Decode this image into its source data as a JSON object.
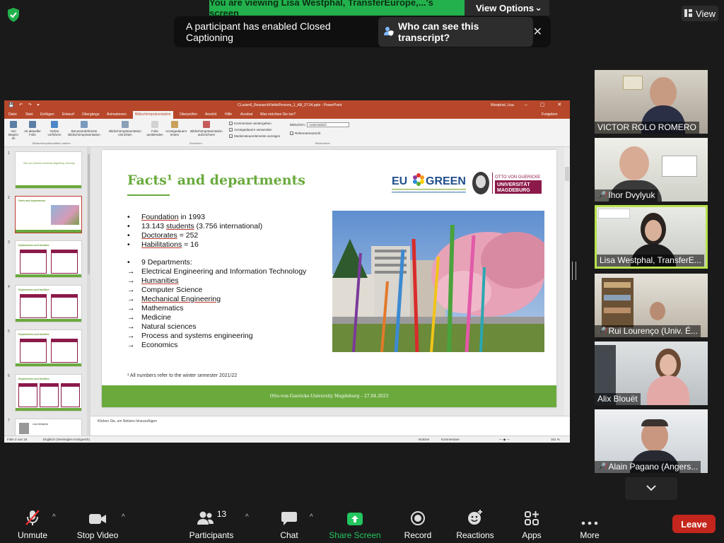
{
  "banner": {
    "sharing_text": "You are viewing Lisa Westphal, TransferEurope,...'s screen",
    "view_options": "View Options"
  },
  "top_view": "View",
  "caption_popup": {
    "message": "A participant has enabled Closed Captioning",
    "button": "Who can see this transcript?"
  },
  "ppt": {
    "title": "CLuster6_ResearchFieldsPersons_1_AB_27.04.pptx  -  PowerPoint",
    "user": "Westphal, Lisa",
    "tabs": [
      "Datei",
      "Start",
      "Einfügen",
      "Entwurf",
      "Übergänge",
      "Animationen",
      "Bildschirmpräsentation",
      "Überprüfen",
      "Ansicht",
      "Hilfe",
      "Acrobat",
      "Was möchten Sie tun?",
      "Freigeben"
    ],
    "ribbon": {
      "buttons": [
        "Von Beginn an",
        "Ab aktueller Folie",
        "Online vorführen",
        "Benutzerdefinierte Bildschirmpräsentation",
        "Bildschirmpräsentation einrichten",
        "Folie ausblenden",
        "Anzeigedauern testen",
        "Bildschirmpräsentation aufzeichnen"
      ],
      "checkboxes": [
        "Kommentare wiedergeben",
        "Anzeigedauern verwenden",
        "Mediensteuerelemente anzeigen"
      ],
      "groups": [
        "Bildschirmpräsentation starten",
        "Einrichten",
        "Bildschirme"
      ],
      "monitor_label": "Bildschirm:",
      "monitor_value": "Automatisch",
      "presenter_view": "Referentenansicht"
    },
    "notes_placeholder": "Klicken Sie, um Notizen hinzuzufügen",
    "status": {
      "slide": "Folie 2 von 15",
      "language": "Englisch (Vereinigtes Königreich)",
      "notes": "Notizen",
      "comments": "Kommentare",
      "zoom": "161 %"
    },
    "thumbs": [
      {
        "num": "1",
        "title": "Otto-von-Guericke-University Magdeburg, Germany"
      },
      {
        "num": "2",
        "title": "Facts and departments"
      },
      {
        "num": "3",
        "title": "Departments and facilities"
      },
      {
        "num": "4",
        "title": "Departments and facilities"
      },
      {
        "num": "5",
        "title": "Departments and facilities"
      },
      {
        "num": "6",
        "title": "Departments and facilities"
      },
      {
        "num": "7",
        "title": "Lisa Westphal"
      }
    ]
  },
  "slide": {
    "title": "Facts¹ and departments",
    "eu_green": "EU GREEN",
    "ovgu": "OTTO VON GUERICKE UNIVERSITÄT MAGDEBURG",
    "facts": [
      {
        "u": "Foundation",
        "rest": " in 1993"
      },
      {
        "u": "",
        "rest": "13.143 ",
        "u2": "students",
        "rest2": " (3.756 international)"
      },
      {
        "u": "Doctorates",
        "rest": " = 252"
      },
      {
        "u": "Habilitations",
        "rest": " = 16"
      }
    ],
    "dept_count": "9 Departments:",
    "departments": [
      "Electrical Engineering and Information Technology",
      "Humanities",
      "Computer Science",
      "Mechanical Engineering",
      "Mathematics",
      "Medicine",
      "Natural sciences",
      "Process and systems engineering",
      "Economics"
    ],
    "footnote": "¹ All numbers refer to the winter semester 2021/22",
    "footer": "Otto-von-Guericke-University Magdeburg – 27.04.2023"
  },
  "participants": [
    {
      "name": "VICTOR ROLO ROMERO",
      "muted": false
    },
    {
      "name": "Ihor Dvylyuk",
      "muted": true
    },
    {
      "name": "Lisa Westphal, TransferE...",
      "muted": false,
      "active": true
    },
    {
      "name": "Rui Lourenço (Univ. É...",
      "muted": true
    },
    {
      "name": "Alix Blouët",
      "muted": false
    },
    {
      "name": "Alain Pagano (Angers...",
      "muted": true
    }
  ],
  "toolbar": {
    "unmute": "Unmute",
    "stop_video": "Stop Video",
    "participants": "Participants",
    "participant_count": "13",
    "chat": "Chat",
    "share_screen": "Share Screen",
    "record": "Record",
    "reactions": "Reactions",
    "apps": "Apps",
    "more": "More",
    "leave": "Leave"
  },
  "colors": {
    "share_green": "#22b14c",
    "slide_green": "#6aaa3d",
    "ppt_red": "#b7472a",
    "leave_red": "#c4261d",
    "active_border": "#b8e34d"
  }
}
